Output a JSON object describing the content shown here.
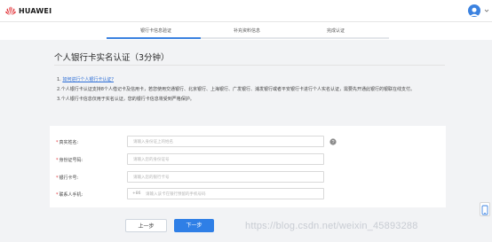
{
  "header": {
    "brand": "HUAWEI"
  },
  "steps": [
    {
      "label": "银行卡信息验证"
    },
    {
      "label": "补充资料信息"
    },
    {
      "label": "完成认证"
    }
  ],
  "main": {
    "title": "个人银行卡实名认证（3分钟）",
    "tips": [
      {
        "prefix": "1. ",
        "text": "如何进行个人银行卡认证?"
      },
      {
        "prefix": "",
        "text": "2.个人银行卡认证支持8个人借记卡及信用卡，若您使用交通银行、北京银行、上海银行、广发银行、浦发银行或者平安银行卡进行个人实名认证，需要先开通此银行的银联在线支付。"
      },
      {
        "prefix": "",
        "text": "3.个人银行卡信息仅用于实名认证，您的银行卡信息将受到严格保护。"
      }
    ]
  },
  "form": {
    "fields": [
      {
        "label": "真实姓名:",
        "placeholder": "请输入身份证上的姓名"
      },
      {
        "label": "身份证号码:",
        "placeholder": "请输入您的身份证号"
      },
      {
        "label": "银行卡号:",
        "placeholder": "请输入您的银行卡号"
      },
      {
        "label": "联系人手机:",
        "prefix": "+86",
        "placeholder": "请输入该卡在银行预留的手机号码"
      }
    ]
  },
  "buttons": {
    "prev": "上一步",
    "next": "下一步"
  },
  "watermark": "https://blog.csdn.net/weixin_45893288",
  "colors": {
    "accent": "#2f7fe6",
    "required": "#e0343a",
    "link": "#2e6fd6"
  }
}
